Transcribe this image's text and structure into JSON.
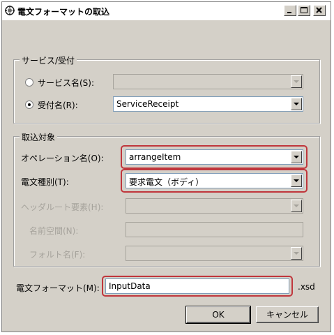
{
  "window": {
    "title": "電文フォーマットの取込",
    "minimize_label": "_",
    "maximize_label": "□",
    "close_label": "×"
  },
  "service_group": {
    "legend": "サービス/受付",
    "service_name_label": "サービス名(S):",
    "service_name_value": "",
    "receipt_name_label": "受付名(R):",
    "receipt_name_value": "ServiceReceipt",
    "selected": "receipt"
  },
  "target_group": {
    "legend": "取込対象",
    "operation_label": "オペレーション名(O):",
    "operation_value": "arrangeItem",
    "message_type_label": "電文種別(T):",
    "message_type_value": "要求電文（ボディ）",
    "header_root_label": "ヘッダルート要素(H):",
    "header_root_value": "",
    "namespace_label": "名前空間(N):",
    "namespace_value": "",
    "fault_name_label": "フォルト名(F):",
    "fault_name_value": ""
  },
  "format": {
    "label": "電文フォーマット(M):",
    "value": "InputData",
    "suffix": ".xsd"
  },
  "buttons": {
    "ok": "OK",
    "cancel": "キャンセル"
  },
  "colors": {
    "highlight": "#c0363c",
    "window_bg": "#d4d0c8"
  }
}
